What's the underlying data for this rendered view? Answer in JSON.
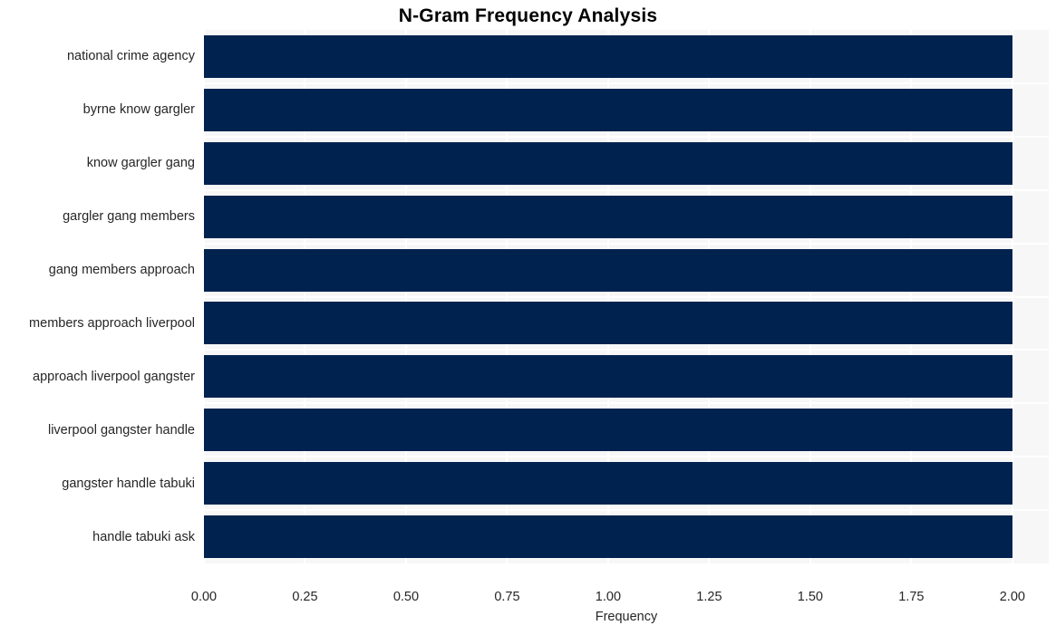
{
  "chart_data": {
    "type": "bar",
    "orientation": "horizontal",
    "title": "N-Gram Frequency Analysis",
    "xlabel": "Frequency",
    "ylabel": "",
    "xlim": [
      0.0,
      2.09
    ],
    "ylim": [
      0,
      10
    ],
    "grid": true,
    "legend": null,
    "bar_color": "#00224f",
    "plot_background": "#f7f7f7",
    "gridline_color": "#ffffff",
    "text_color": "#262626",
    "title_color": "#000000",
    "xticks": [
      "0.00",
      "0.25",
      "0.50",
      "0.75",
      "1.00",
      "1.25",
      "1.50",
      "1.75",
      "2.00"
    ],
    "xtick_values": [
      0.0,
      0.25,
      0.5,
      0.75,
      1.0,
      1.25,
      1.5,
      1.75,
      2.0
    ],
    "categories": [
      "national crime agency",
      "byrne know gargler",
      "know gargler gang",
      "gargler gang members",
      "gang members approach",
      "members approach liverpool",
      "approach liverpool gangster",
      "liverpool gangster handle",
      "gangster handle tabuki",
      "handle tabuki ask"
    ],
    "values": [
      2,
      2,
      2,
      2,
      2,
      2,
      2,
      2,
      2,
      2
    ]
  }
}
